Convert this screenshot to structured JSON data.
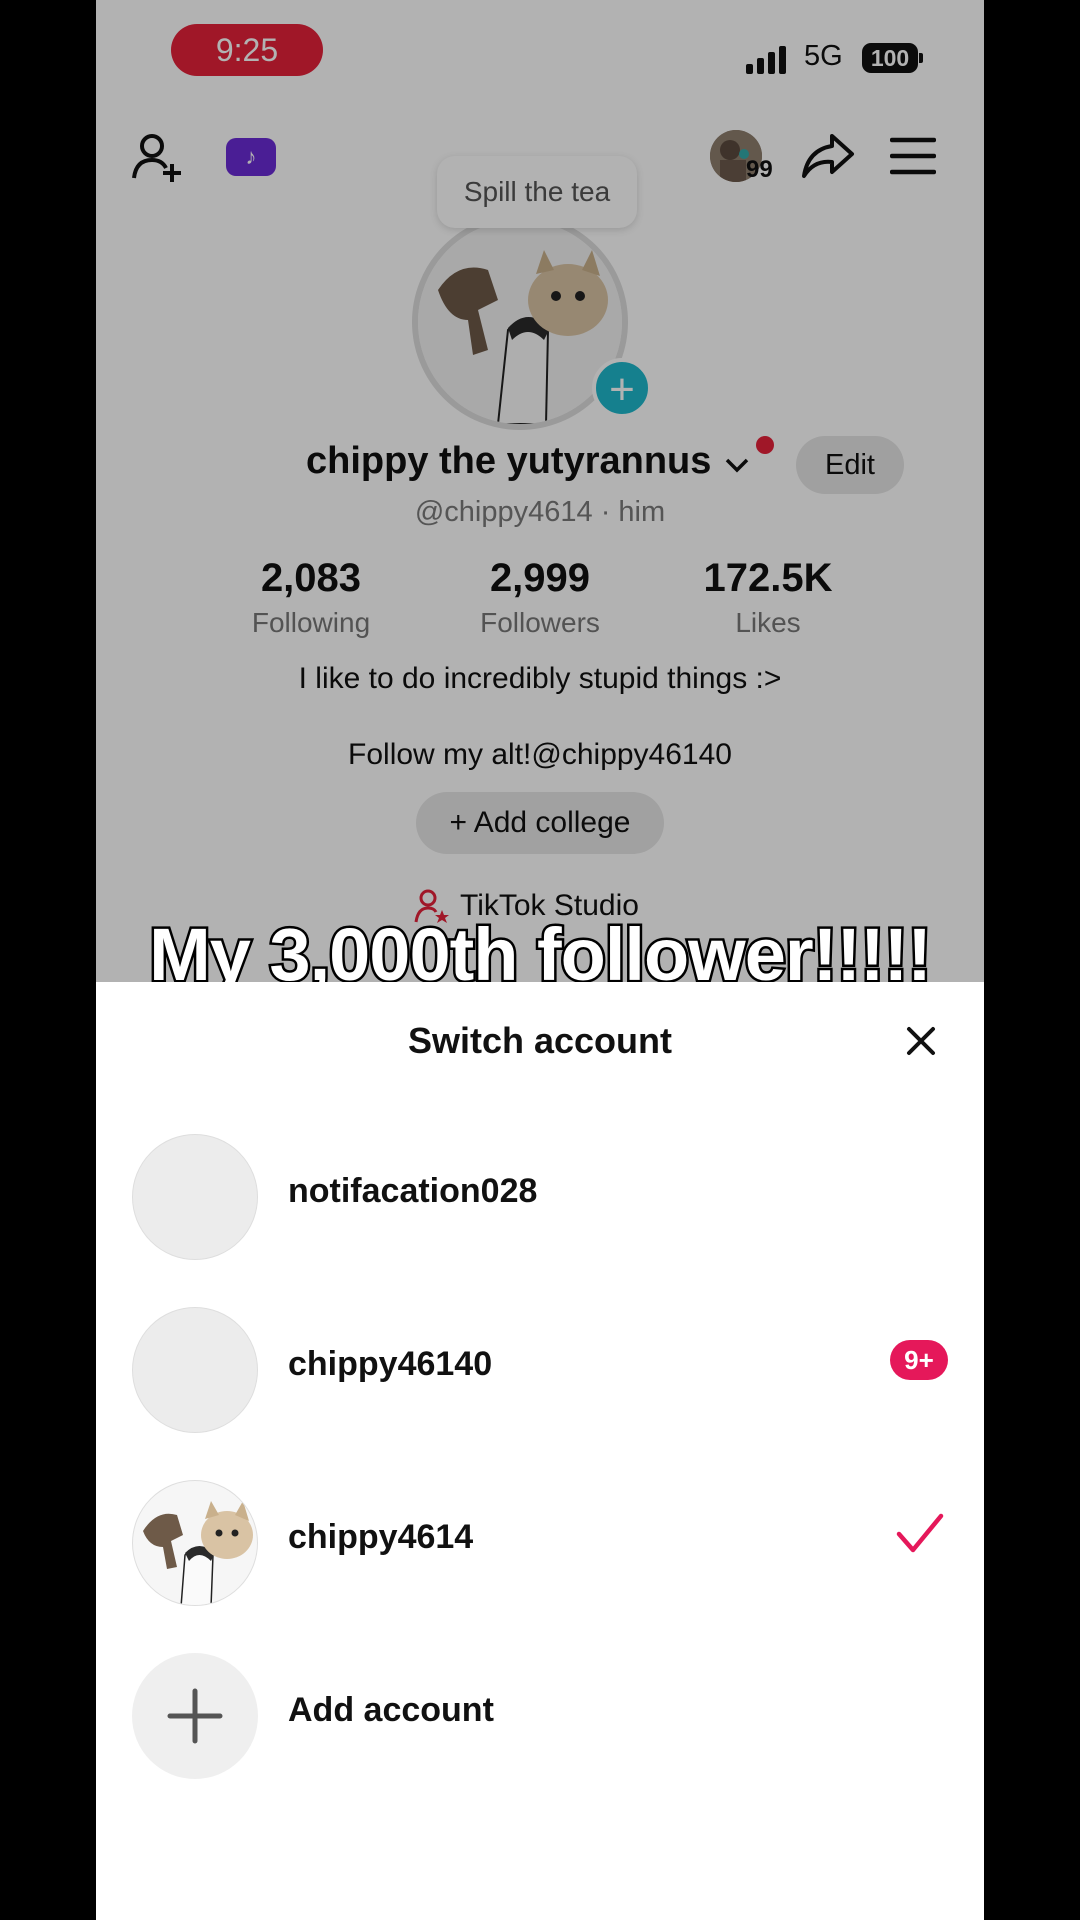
{
  "status_bar": {
    "time": "9:25",
    "network": "5G",
    "battery": "100"
  },
  "header": {
    "notification_count": "99"
  },
  "profile": {
    "tooltip": "Spill the tea",
    "display_name": "chippy the yutyrannus",
    "edit_label": "Edit",
    "username": "@chippy4614 · him",
    "stats": [
      {
        "value": "2,083",
        "label": "Following"
      },
      {
        "value": "2,999",
        "label": "Followers"
      },
      {
        "value": "172.5K",
        "label": "Likes"
      }
    ],
    "bio_line1": "I like to do incredibly stupid things :>",
    "bio_line2": "Follow my alt!@chippy46140",
    "add_college": "+ Add college",
    "studio_label": "TikTok Studio"
  },
  "caption": "My 3,000th follower!!!!!",
  "switch_sheet": {
    "title": "Switch account",
    "accounts": [
      {
        "name": "notifacation028"
      },
      {
        "name": "chippy46140",
        "badge": "9+"
      },
      {
        "name": "chippy4614",
        "selected": true
      }
    ],
    "add_label": "Add account"
  },
  "colors": {
    "accent_red": "#e5213a",
    "badge_pink": "#e5185a",
    "teal": "#1fb8cc",
    "purple": "#6b2cd6"
  }
}
